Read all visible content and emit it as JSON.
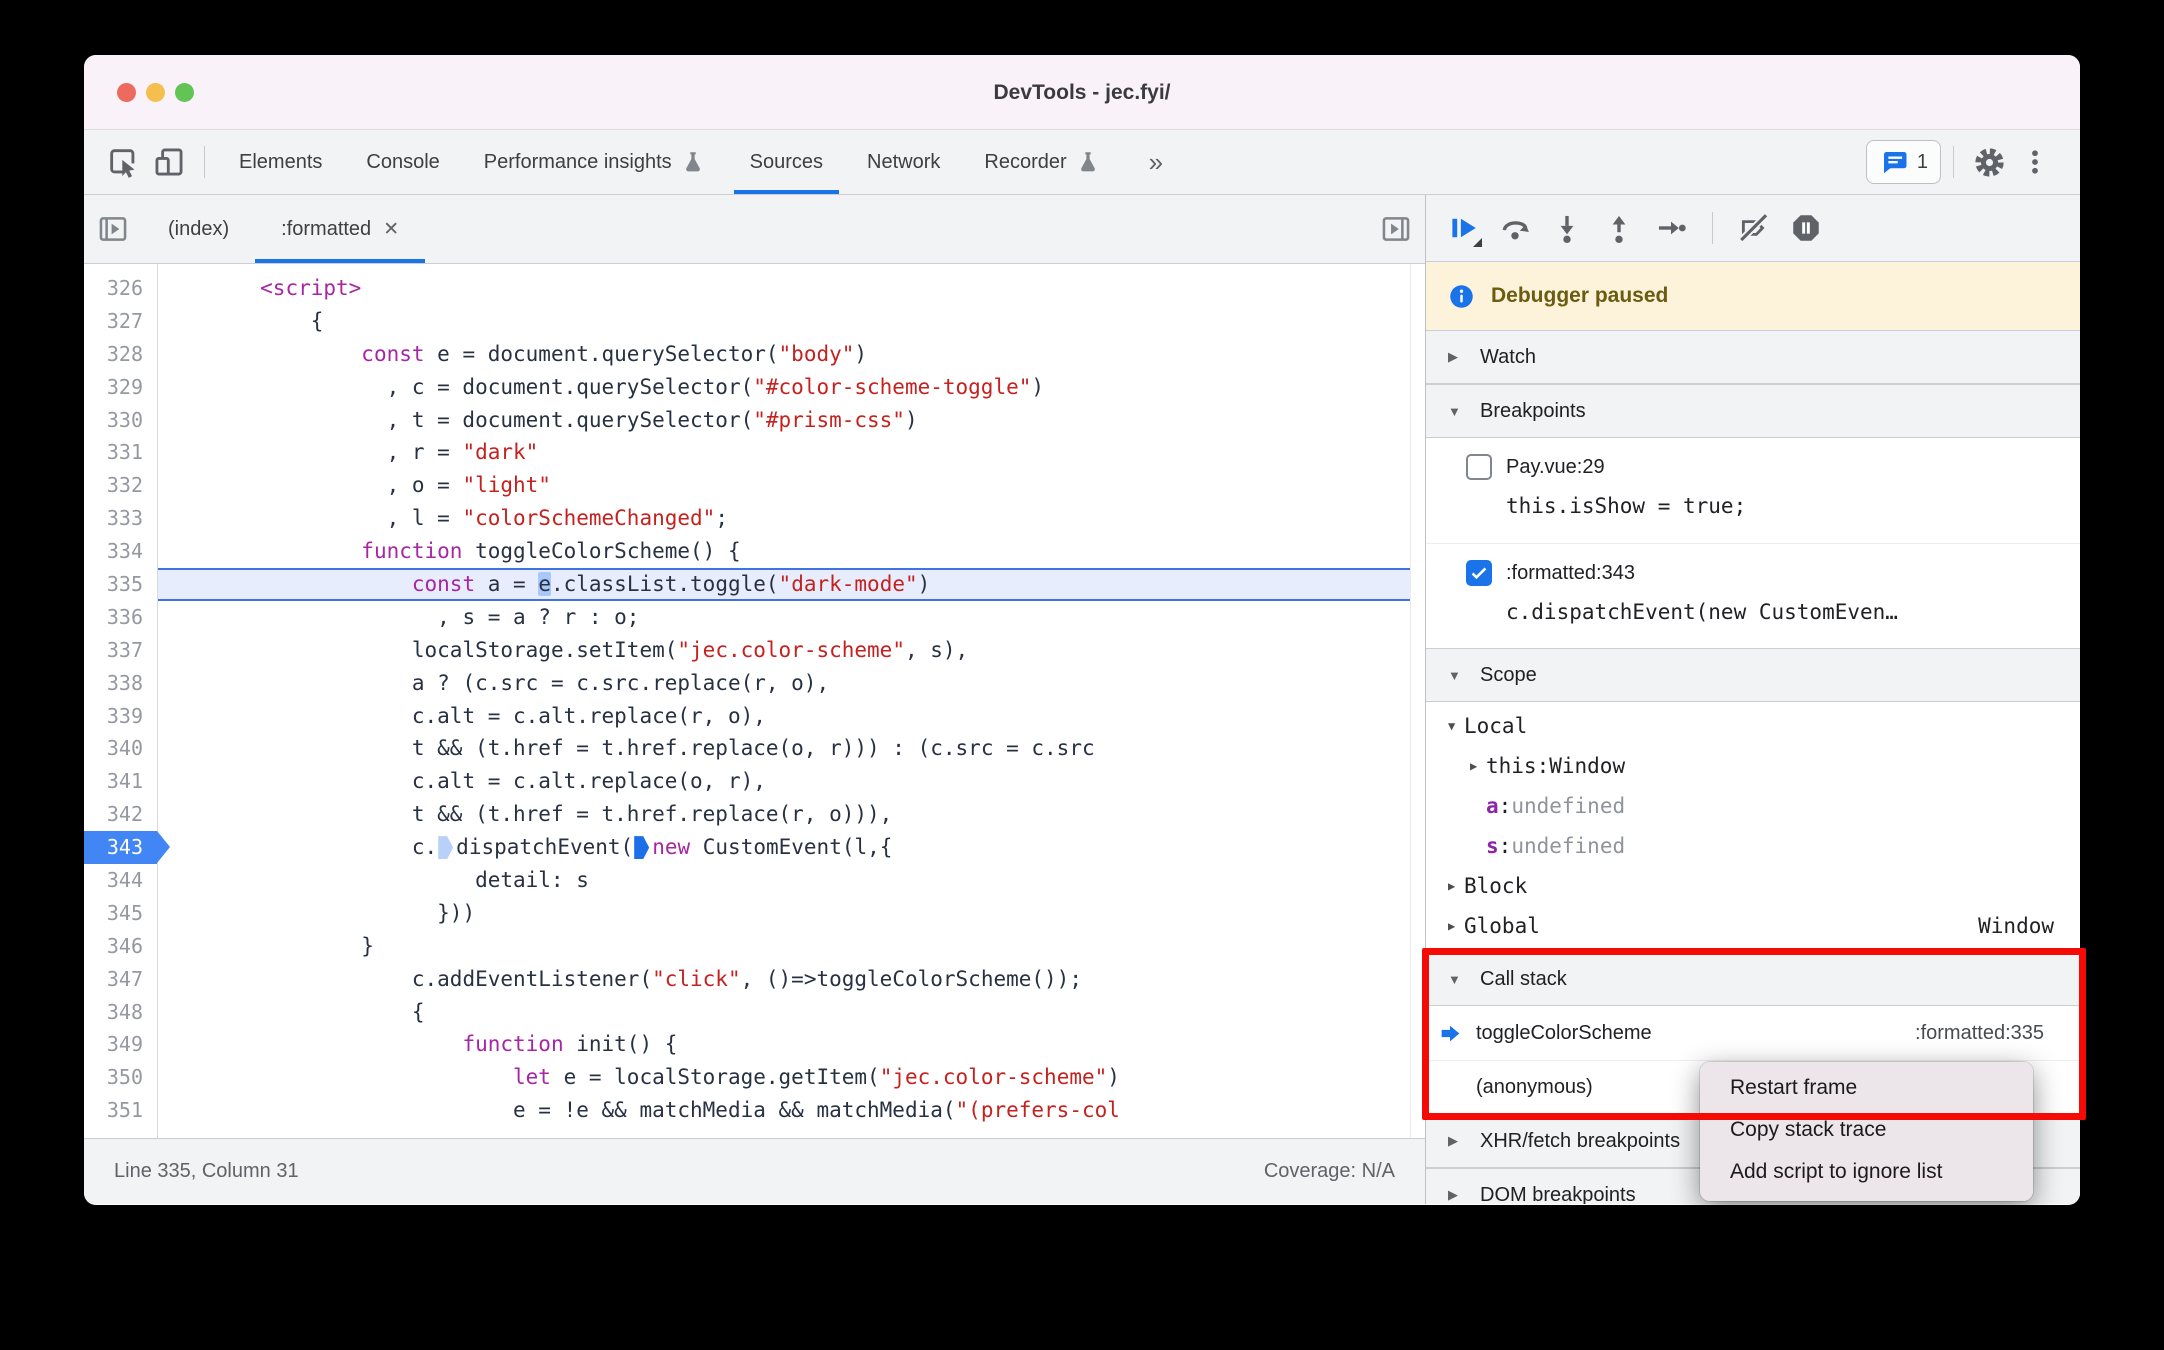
{
  "window": {
    "title": "DevTools - jec.fyi/"
  },
  "toolbar": {
    "tabs": [
      {
        "label": "Elements"
      },
      {
        "label": "Console"
      },
      {
        "label": "Performance insights",
        "flask": true
      },
      {
        "label": "Sources",
        "active": true
      },
      {
        "label": "Network"
      },
      {
        "label": "Recorder",
        "flask": true
      }
    ],
    "overflow_chevron": "»",
    "chat_badge_count": "1"
  },
  "file_tabs": {
    "tabs": [
      {
        "label": "(index)"
      },
      {
        "label": ":formatted",
        "active": true,
        "close": "✕"
      }
    ]
  },
  "editor": {
    "current_line": 335,
    "execution_line": 343,
    "lines": [
      {
        "n": 326,
        "ind": 8,
        "t": [
          [
            "k",
            "<script>"
          ]
        ]
      },
      {
        "n": 327,
        "ind": 12,
        "t": [
          [
            "d",
            "{"
          ]
        ]
      },
      {
        "n": 328,
        "ind": 16,
        "t": [
          [
            "k",
            "const"
          ],
          [
            "d",
            " e = document.querySelector("
          ],
          [
            "s",
            "\"body\""
          ],
          [
            "d",
            ")"
          ]
        ]
      },
      {
        "n": 329,
        "ind": 18,
        "t": [
          [
            "d",
            ", c = document.querySelector("
          ],
          [
            "s",
            "\"#color-scheme-toggle\""
          ],
          [
            "d",
            ")"
          ]
        ]
      },
      {
        "n": 330,
        "ind": 18,
        "t": [
          [
            "d",
            ", t = document.querySelector("
          ],
          [
            "s",
            "\"#prism-css\""
          ],
          [
            "d",
            ")"
          ]
        ]
      },
      {
        "n": 331,
        "ind": 18,
        "t": [
          [
            "d",
            ", r = "
          ],
          [
            "s",
            "\"dark\""
          ]
        ]
      },
      {
        "n": 332,
        "ind": 18,
        "t": [
          [
            "d",
            ", o = "
          ],
          [
            "s",
            "\"light\""
          ]
        ]
      },
      {
        "n": 333,
        "ind": 18,
        "t": [
          [
            "d",
            ", l = "
          ],
          [
            "s",
            "\"colorSchemeChanged\""
          ],
          [
            "d",
            ";"
          ]
        ]
      },
      {
        "n": 334,
        "ind": 16,
        "t": [
          [
            "k",
            "function"
          ],
          [
            "d",
            " toggleColorScheme() {"
          ]
        ]
      },
      {
        "n": 335,
        "ind": 20,
        "hl": true,
        "t": [
          [
            "k",
            "const"
          ],
          [
            "d",
            " a = "
          ],
          [
            "sel",
            "e"
          ],
          [
            "d",
            ".classList.toggle("
          ],
          [
            "s",
            "\"dark-mode\""
          ],
          [
            "d",
            ")"
          ]
        ]
      },
      {
        "n": 336,
        "ind": 22,
        "t": [
          [
            "d",
            ", s = a ? r : o;"
          ]
        ]
      },
      {
        "n": 337,
        "ind": 20,
        "t": [
          [
            "d",
            "localStorage.setItem("
          ],
          [
            "s",
            "\"jec.color-scheme\""
          ],
          [
            "d",
            ", s),"
          ]
        ]
      },
      {
        "n": 338,
        "ind": 20,
        "t": [
          [
            "d",
            "a ? (c.src = c.src.replace(r, o),"
          ]
        ]
      },
      {
        "n": 339,
        "ind": 20,
        "t": [
          [
            "d",
            "c.alt = c.alt.replace(r, o),"
          ]
        ]
      },
      {
        "n": 340,
        "ind": 20,
        "t": [
          [
            "d",
            "t && (t.href = t.href.replace(o, r))) : (c.src = c.src"
          ]
        ]
      },
      {
        "n": 341,
        "ind": 20,
        "t": [
          [
            "d",
            "c.alt = c.alt.replace(o, r),"
          ]
        ]
      },
      {
        "n": 342,
        "ind": 20,
        "t": [
          [
            "d",
            "t && (t.href = t.href.replace(r, o))),"
          ]
        ]
      },
      {
        "n": 343,
        "ind": 20,
        "exec": true,
        "t": [
          [
            "d",
            "c."
          ],
          [
            "m1",
            ""
          ],
          [
            "d",
            "dispatchEvent("
          ],
          [
            "m2",
            ""
          ],
          [
            "k",
            "new"
          ],
          [
            "d",
            " CustomEvent(l,{"
          ]
        ]
      },
      {
        "n": 344,
        "ind": 25,
        "t": [
          [
            "d",
            "detail: s"
          ]
        ]
      },
      {
        "n": 345,
        "ind": 22,
        "t": [
          [
            "d",
            "}))"
          ]
        ]
      },
      {
        "n": 346,
        "ind": 16,
        "t": [
          [
            "d",
            "}"
          ]
        ]
      },
      {
        "n": 347,
        "ind": 20,
        "t": [
          [
            "d",
            "c.addEventListener("
          ],
          [
            "s",
            "\"click\""
          ],
          [
            "d",
            ", ()=>toggleColorScheme());"
          ]
        ]
      },
      {
        "n": 348,
        "ind": 20,
        "t": [
          [
            "d",
            "{"
          ]
        ]
      },
      {
        "n": 349,
        "ind": 24,
        "t": [
          [
            "k",
            "function"
          ],
          [
            "d",
            " init() {"
          ]
        ]
      },
      {
        "n": 350,
        "ind": 28,
        "t": [
          [
            "k",
            "let"
          ],
          [
            "d",
            " e = localStorage.getItem("
          ],
          [
            "s",
            "\"jec.color-scheme\""
          ],
          [
            "d",
            ")"
          ]
        ]
      },
      {
        "n": 351,
        "ind": 28,
        "t": [
          [
            "d",
            "e = !e && matchMedia && matchMedia("
          ],
          [
            "s",
            "\"(prefers-col"
          ]
        ]
      }
    ]
  },
  "status_bar": {
    "position": "Line 335, Column 31",
    "coverage": "Coverage: N/A"
  },
  "sidebar": {
    "paused_label": "Debugger paused",
    "sections": {
      "watch": "Watch",
      "breakpoints": "Breakpoints",
      "scope": "Scope",
      "call_stack": "Call stack",
      "xhr": "XHR/fetch breakpoints",
      "dom": "DOM breakpoints"
    },
    "breakpoint_items": [
      {
        "checked": false,
        "label": "Pay.vue:29",
        "code": "this.isShow = true;"
      },
      {
        "checked": true,
        "label": ":formatted:343",
        "code": "c.dispatchEvent(new CustomEven…"
      }
    ],
    "scope_rows": [
      {
        "arrow": "▼",
        "name": "Local"
      },
      {
        "arrow": "▶",
        "name": "this",
        "sep": ": ",
        "value": "Window",
        "vclass": "obj",
        "indent": true
      },
      {
        "arrow": "",
        "name": "a",
        "sep": ": ",
        "value": "undefined",
        "vclass": "undef",
        "nclass": "var",
        "indent": true
      },
      {
        "arrow": "",
        "name": "s",
        "sep": ": ",
        "value": "undefined",
        "vclass": "undef",
        "nclass": "var",
        "indent": true
      },
      {
        "arrow": "▶",
        "name": "Block"
      },
      {
        "arrow": "▶",
        "name": "Global",
        "right": "Window"
      }
    ],
    "call_stack_frames": [
      {
        "active": true,
        "fn": "toggleColorScheme",
        "loc": ":formatted:335"
      },
      {
        "active": false,
        "fn": "(anonymous)",
        "loc": ""
      }
    ],
    "triangles": {
      "watch": "▶",
      "breakpoints": "▼",
      "scope": "▼",
      "call_stack": "▼",
      "xhr": "▶",
      "dom": "▶"
    }
  },
  "context_menu": {
    "items": [
      "Restart frame",
      "Copy stack trace",
      "Add script to ignore list"
    ]
  },
  "colors": {
    "accent": "#1a73e8",
    "keyword": "#a626a4",
    "string": "#c5221f",
    "execution_badge": "#4285f4",
    "paused_banner_bg": "#fcf3da",
    "annotation_red": "#f50b06",
    "traffic_lights": [
      "#ed6a5e",
      "#f5bf4f",
      "#61c454"
    ]
  }
}
